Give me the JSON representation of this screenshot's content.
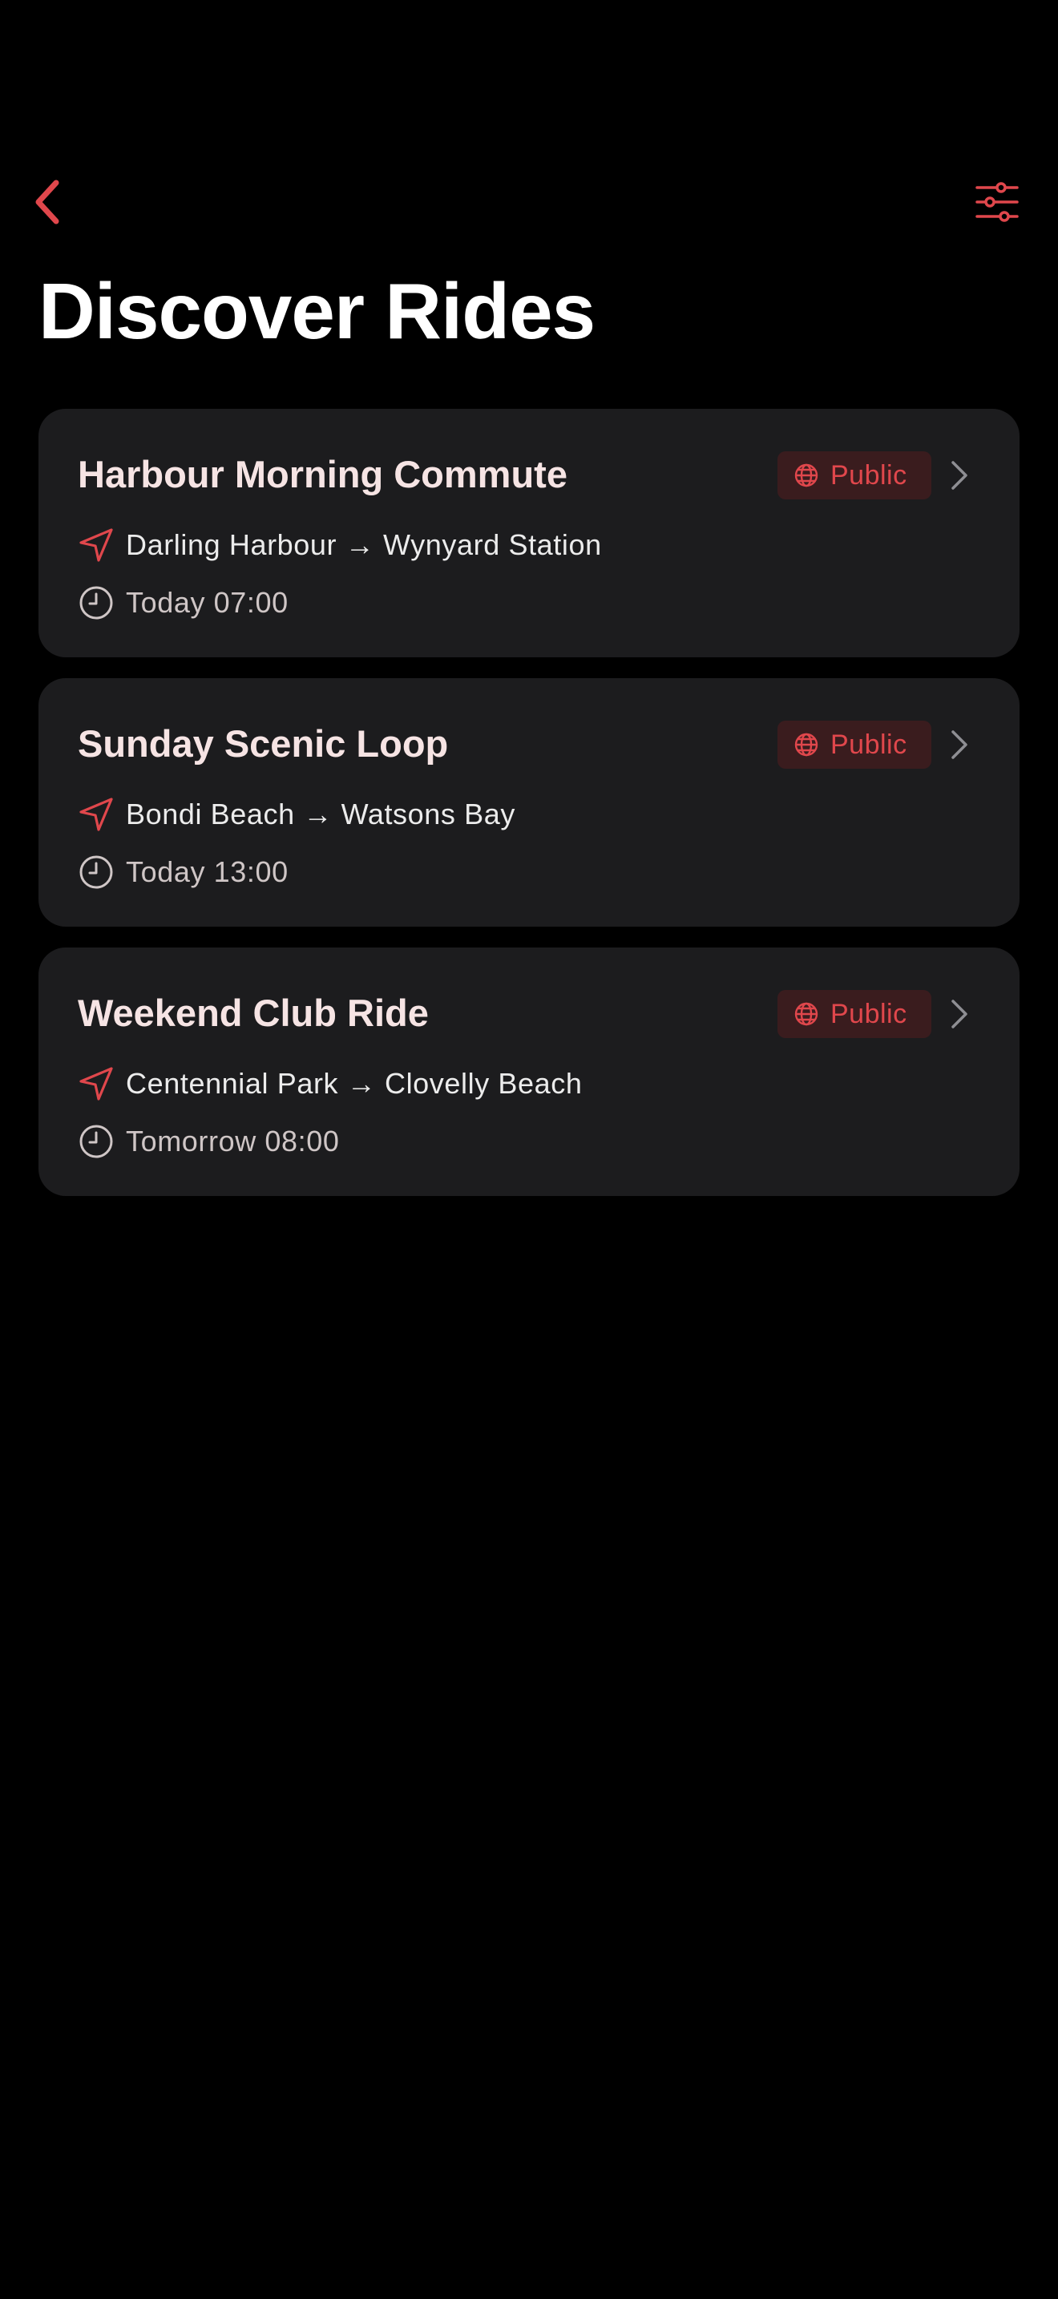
{
  "colors": {
    "accent": "#e0474c",
    "background": "#000000",
    "card": "#1c1c1e",
    "badge_bg": "#3a1c1e"
  },
  "nav": {
    "back_icon": "chevron-left-icon",
    "filter_icon": "sliders-icon"
  },
  "header": {
    "title": "Discover Rides"
  },
  "rides": [
    {
      "title": "Harbour Morning Commute",
      "badge": "Public",
      "from": "Darling Harbour",
      "arrow": "→",
      "to": "Wynyard Station",
      "time": "Today 07:00"
    },
    {
      "title": "Sunday Scenic Loop",
      "badge": "Public",
      "from": "Bondi Beach",
      "arrow": "→",
      "to": "Watsons Bay",
      "time": "Today 13:00"
    },
    {
      "title": "Weekend Club Ride",
      "badge": "Public",
      "from": "Centennial Park",
      "arrow": "→",
      "to": "Clovelly Beach",
      "time": "Tomorrow 08:00"
    }
  ]
}
